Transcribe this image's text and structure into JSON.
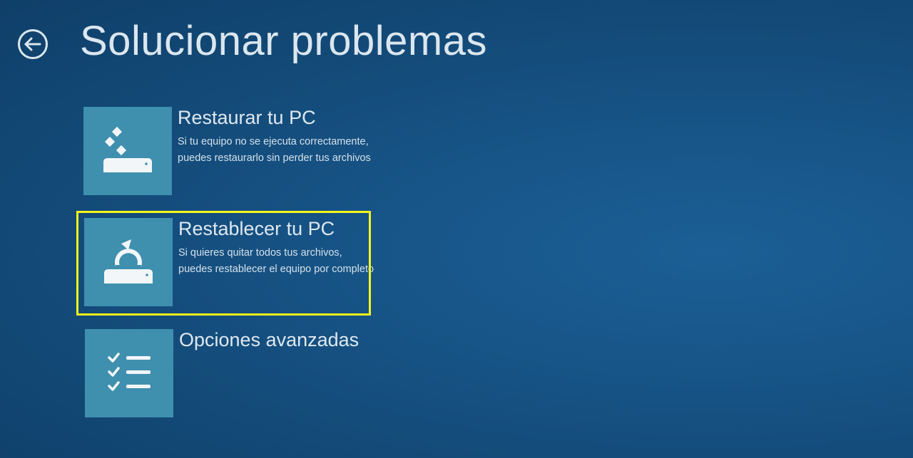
{
  "header": {
    "title": "Solucionar problemas",
    "back_icon": "back-arrow-icon"
  },
  "options": [
    {
      "title": "Restaurar tu PC",
      "description": "Si tu equipo no se ejecuta correctamente, puedes restaurarlo sin perder tus archivos",
      "icon": "restore-pc-icon"
    },
    {
      "title": "Restablecer tu PC",
      "description": "Si quieres quitar todos tus archivos, puedes restablecer el equipo por completo",
      "icon": "reset-pc-icon"
    },
    {
      "title": "Opciones avanzadas",
      "description": "",
      "icon": "advanced-options-icon"
    }
  ],
  "colors": {
    "background": "#134a78",
    "tile": "#3f8fae",
    "highlight": "#f5f51a",
    "text": "#dfe8ef"
  }
}
